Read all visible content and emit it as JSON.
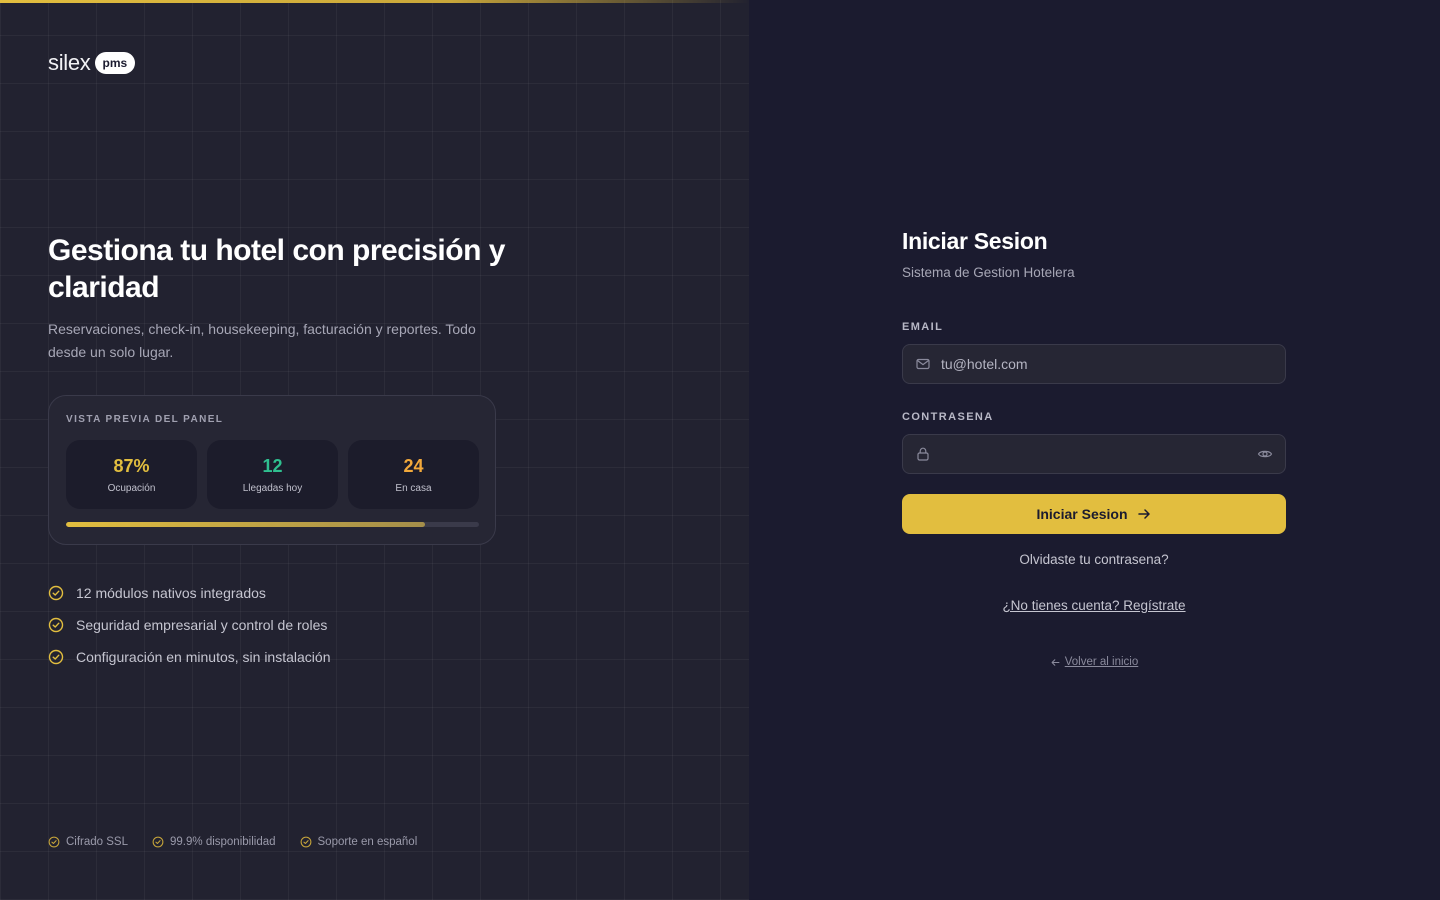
{
  "brand": {
    "name": "silex",
    "badge": "pms"
  },
  "hero": {
    "title": "Gestiona tu hotel con precisión y claridad",
    "subtitle": "Reservaciones, check-in, housekeeping, facturación y reportes. Todo desde un solo lugar."
  },
  "panel": {
    "label": "VISTA PREVIA DEL PANEL",
    "stats": [
      {
        "value": "87%",
        "label": "Ocupación",
        "color": "#e2be3f"
      },
      {
        "value": "12",
        "label": "Llegadas hoy",
        "color": "#2fbf8f"
      },
      {
        "value": "24",
        "label": "En casa",
        "color": "#f2a93b"
      }
    ],
    "progress": 0.87
  },
  "features": [
    "12 módulos nativos integrados",
    "Seguridad empresarial y control de roles",
    "Configuración en minutos, sin instalación"
  ],
  "footer_badges": [
    "Cifrado SSL",
    "99.9% disponibilidad",
    "Soporte en español"
  ],
  "form": {
    "title": "Iniciar Sesion",
    "subtitle": "Sistema de Gestion Hotelera",
    "email_label": "EMAIL",
    "email_placeholder": "tu@hotel.com",
    "password_label": "CONTRASENA",
    "password_placeholder": "",
    "submit_label": "Iniciar Sesion",
    "forgot_label": "Olvidaste tu contrasena?",
    "register_label": "¿No tienes cuenta? Regístrate",
    "back_label": "Volver al inicio"
  },
  "colors": {
    "accent": "#e2be3f",
    "left_bg": "#222230",
    "right_bg": "#1b1b2f"
  },
  "icons": {
    "email": "mail-icon",
    "password": "lock-icon",
    "toggle": "eye-icon",
    "submit": "arrow-right-icon",
    "back": "arrow-left-icon",
    "feature": "check-circle-icon"
  }
}
